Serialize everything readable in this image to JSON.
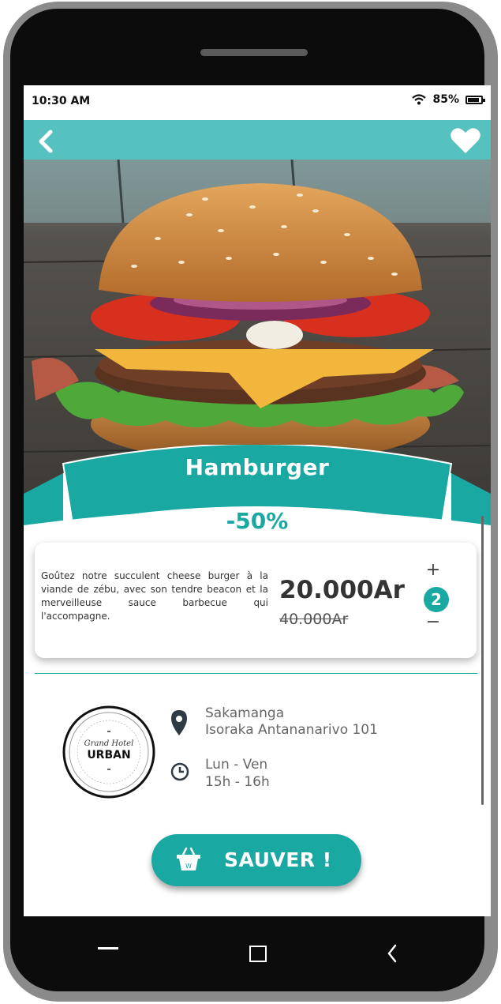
{
  "status_bar": {
    "time": "10:30 AM",
    "battery": "85%",
    "icons": [
      "wifi-icon",
      "battery-icon"
    ]
  },
  "header": {
    "back_icon": "back-chevron-icon",
    "favorite_icon": "heart-icon"
  },
  "product": {
    "name": "Hamburger",
    "discount": "-50%",
    "description": "Goûtez notre succulent cheese burger à la viande de zébu, avec son tendre beacon et la merveilleuse sauce barbecue qui l'accompagne.",
    "price_new": "20.000Ar",
    "price_old": "40.000Ar",
    "quantity": "2",
    "qty_plus": "+",
    "qty_minus": "−"
  },
  "shop": {
    "logo_text": "URBAN",
    "logo_script": "Grand Hotel",
    "address_line1": "Sakamanga",
    "address_line2": "Isoraka Antananarivo 101",
    "days": "Lun - Ven",
    "hours": "15h - 16h"
  },
  "action": {
    "save_label": "SAUVER !",
    "save_icon": "basket-icon"
  },
  "colors": {
    "accent": "#1aa8a2",
    "accent_light": "#56c2c0",
    "text_dark": "#333333"
  },
  "nav": {
    "icons": [
      "recent-apps-icon",
      "home-icon",
      "nav-back-icon"
    ]
  }
}
